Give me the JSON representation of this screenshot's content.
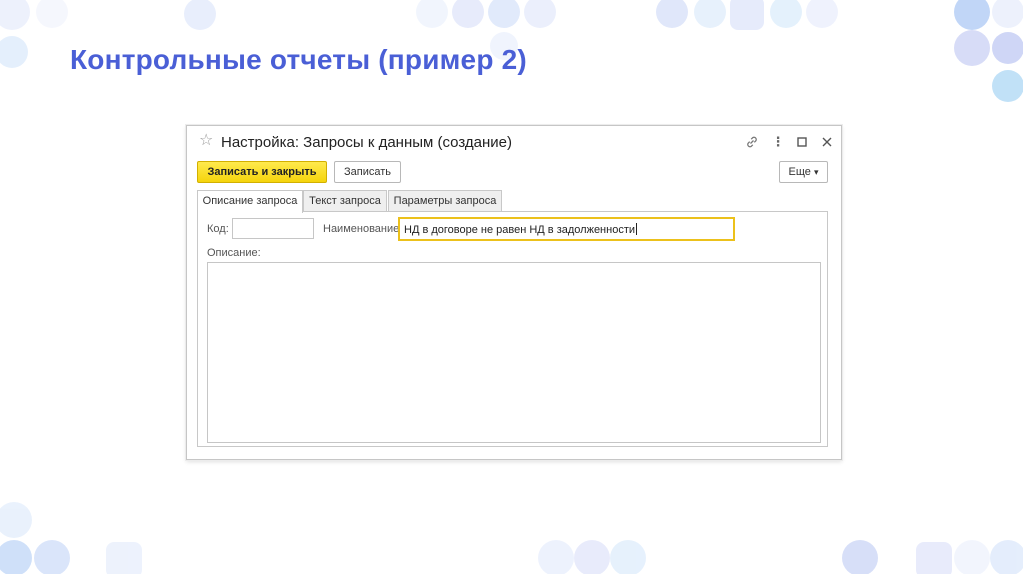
{
  "slide": {
    "title": "Контрольные отчеты (пример 2)"
  },
  "window": {
    "title": "Настройка: Запросы к данным (создание)",
    "icons": [
      "star-icon",
      "link-icon",
      "more-vert-icon",
      "maximize-icon",
      "close-icon"
    ],
    "icon_glyphs": {
      "star": "☆",
      "link": "🔗",
      "more": "⋮",
      "maximize": "☐",
      "close": "✕"
    }
  },
  "toolbar": {
    "save_close_label": "Записать и закрыть",
    "save_label": "Записать",
    "more_label": "Еще",
    "more_chevron": "▾"
  },
  "tabs": [
    {
      "label": "Описание запроса",
      "active": true
    },
    {
      "label": "Текст запроса",
      "active": false
    },
    {
      "label": "Параметры запроса",
      "active": false
    }
  ],
  "form": {
    "code_label": "Код:",
    "code_value": "",
    "name_label": "Наименование:",
    "name_value": "НД в договоре не равен НД в задолженности",
    "description_label": "Описание:",
    "description_value": ""
  },
  "colors": {
    "title": "#4a5fd6",
    "primary_button": "#f5d40c",
    "focus_border": "#ecc11b",
    "deco_blue": "#a9c8f5",
    "deco_lavender": "#c9cdf4"
  }
}
